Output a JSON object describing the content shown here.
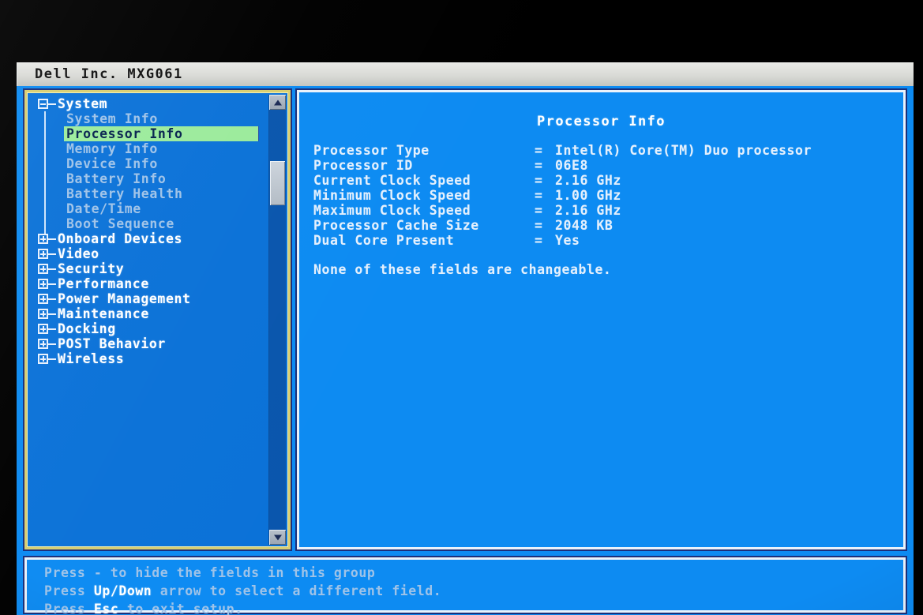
{
  "window": {
    "title": "Dell Inc. MXG061"
  },
  "colors": {
    "screen_blue": "#0d8bf2",
    "tree_blue": "#0b72d8",
    "tree_border_yellow": "#d9cf72",
    "panel_border_white": "#eaf2fb",
    "selection_green": "#9ceb9c",
    "selection_text": "#06224e",
    "dim_text": "#9fc3e8",
    "bright_text": "#ffffff",
    "titlebar_gray": "#d9dad6"
  },
  "tree": {
    "nodes": [
      {
        "label": "System",
        "level": "top",
        "expander": "minus",
        "selected": false
      },
      {
        "label": "System Info",
        "level": "child",
        "expander": "none",
        "selected": false
      },
      {
        "label": "Processor Info",
        "level": "child",
        "expander": "none",
        "selected": true
      },
      {
        "label": "Memory Info",
        "level": "child",
        "expander": "none",
        "selected": false
      },
      {
        "label": "Device Info",
        "level": "child",
        "expander": "none",
        "selected": false
      },
      {
        "label": "Battery Info",
        "level": "child",
        "expander": "none",
        "selected": false
      },
      {
        "label": "Battery Health",
        "level": "child",
        "expander": "none",
        "selected": false
      },
      {
        "label": "Date/Time",
        "level": "child",
        "expander": "none",
        "selected": false
      },
      {
        "label": "Boot Sequence",
        "level": "child",
        "expander": "none",
        "selected": false
      },
      {
        "label": "Onboard Devices",
        "level": "top",
        "expander": "plus",
        "selected": false
      },
      {
        "label": "Video",
        "level": "top",
        "expander": "plus",
        "selected": false
      },
      {
        "label": "Security",
        "level": "top",
        "expander": "plus",
        "selected": false
      },
      {
        "label": "Performance",
        "level": "top",
        "expander": "plus",
        "selected": false
      },
      {
        "label": "Power Management",
        "level": "top",
        "expander": "plus",
        "selected": false
      },
      {
        "label": "Maintenance",
        "level": "top",
        "expander": "plus",
        "selected": false
      },
      {
        "label": "Docking",
        "level": "top",
        "expander": "plus",
        "selected": false
      },
      {
        "label": "POST Behavior",
        "level": "top",
        "expander": "plus",
        "selected": false
      },
      {
        "label": "Wireless",
        "level": "top",
        "expander": "plus",
        "selected": false
      }
    ],
    "scrollbar": {
      "up_arrow_icon": "arrow-up-icon",
      "down_arrow_icon": "arrow-down-icon"
    }
  },
  "content": {
    "title": "Processor Info",
    "separator": "=",
    "fields": [
      {
        "label": "Processor Type",
        "value": "Intel(R) Core(TM) Duo processor"
      },
      {
        "label": "Processor ID",
        "value": "06E8"
      },
      {
        "label": "Current Clock Speed",
        "value": "2.16 GHz"
      },
      {
        "label": "Minimum Clock Speed",
        "value": "1.00 GHz"
      },
      {
        "label": "Maximum Clock Speed",
        "value": "2.16 GHz"
      },
      {
        "label": "Processor Cache Size",
        "value": "2048 KB"
      },
      {
        "label": "Dual Core Present",
        "value": "Yes"
      }
    ],
    "note": "None of these fields are changeable."
  },
  "footer": {
    "lines": [
      {
        "pre": "Press - to hide the fields in this group",
        "kbd": "",
        "post": ""
      },
      {
        "pre": "Press ",
        "kbd": "Up/Down",
        "post": " arrow to select a different field."
      },
      {
        "pre": "Press ",
        "kbd": "Esc",
        "post": " to exit setup."
      }
    ]
  }
}
